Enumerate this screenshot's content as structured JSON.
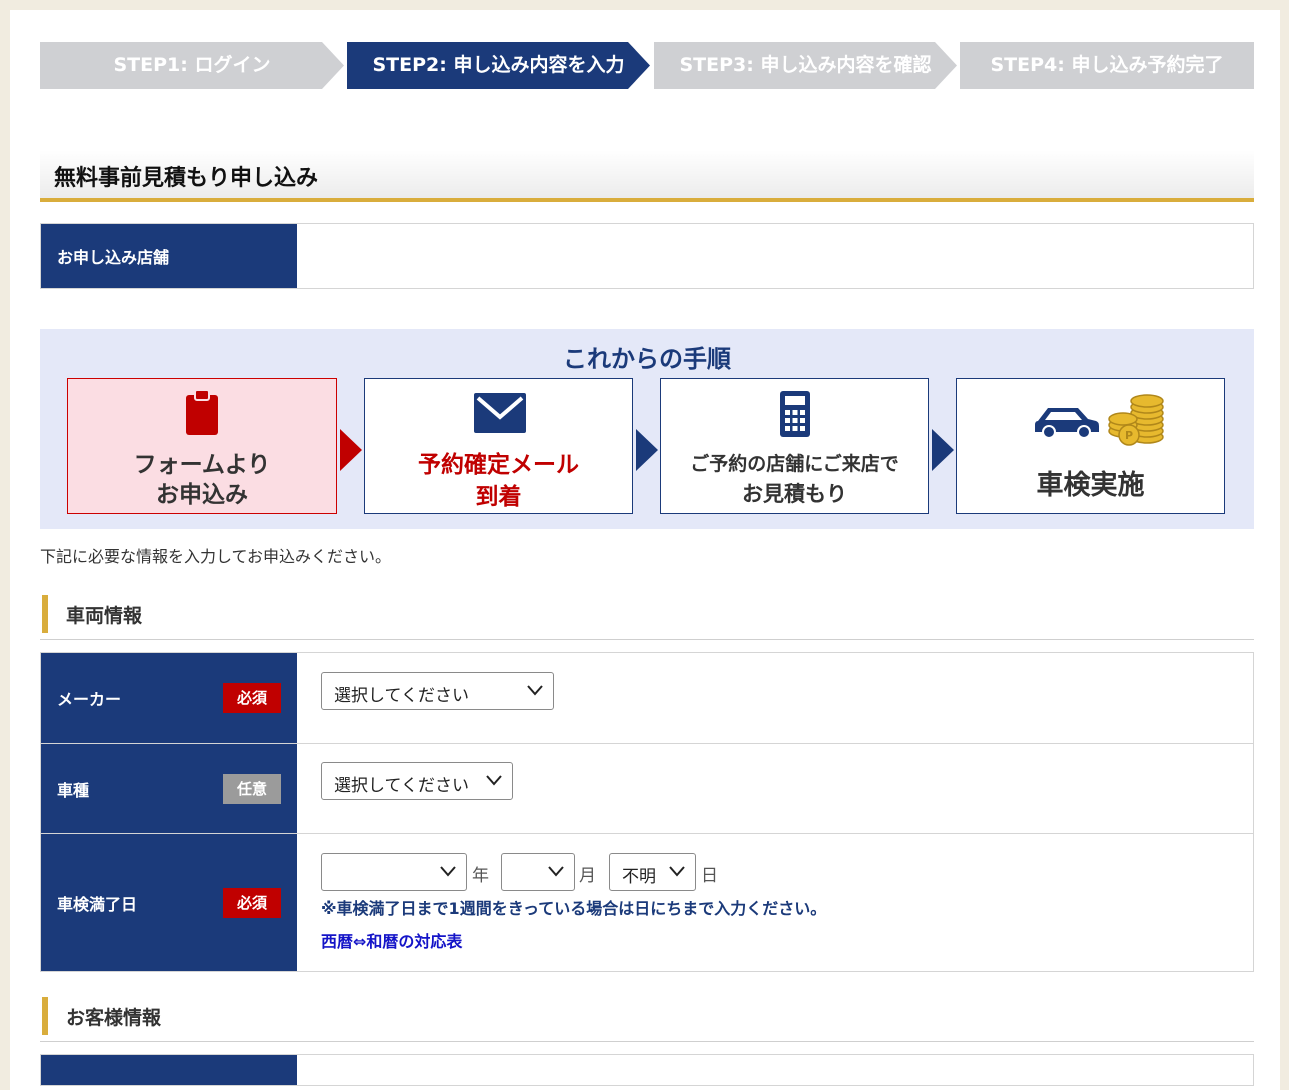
{
  "steps": [
    {
      "label": "STEP1: ログイン",
      "state": "done"
    },
    {
      "label": "STEP2: 申し込み内容を入力",
      "state": "active"
    },
    {
      "label": "STEP3: 申し込み内容を確認",
      "state": "pending"
    },
    {
      "label": "STEP4: 申し込み予約完了",
      "state": "pending"
    }
  ],
  "page_title": "無料事前見積もり申し込み",
  "store": {
    "label": "お申し込み店舗",
    "value": ""
  },
  "procedure": {
    "title": "これからの手順",
    "boxes": [
      {
        "line1": "フォームより",
        "line2": "お申込み",
        "icon": "clipboard-icon"
      },
      {
        "line1": "予約確定メール",
        "line2": "到着",
        "icon": "mail-icon"
      },
      {
        "line1": "ご予約の店舗にご来店で",
        "line2": "お見積もり",
        "icon": "calculator-icon"
      },
      {
        "line1": "車検実施",
        "line2": "",
        "icon": "car-and-coins-icon"
      }
    ]
  },
  "intro": "下記に必要な情報を入力してお申込みください。",
  "vehicle_section": {
    "title": "車両情報",
    "maker": {
      "label": "メーカー",
      "badge": "必須",
      "value": "選択してください"
    },
    "model": {
      "label": "車種",
      "badge": "任意",
      "value": "選択してください"
    },
    "expiry": {
      "label": "車検満了日",
      "badge": "必須",
      "year_value": "",
      "year_unit": "年",
      "month_value": "",
      "month_unit": "月",
      "day_value": "不明",
      "day_unit": "日",
      "note": "※車検満了日まで1週間をきっている場合は日にちまで入力ください。",
      "link": "西暦⇔和暦の対応表"
    }
  },
  "customer_section": {
    "title": "お客様情報"
  },
  "colors": {
    "navy": "#1b3a7a",
    "gold": "#d9ad3c",
    "required_red": "#c00000",
    "optional_gray": "#9b9b9b",
    "step_inactive": "#cfd0d3",
    "procedure_bg": "#e4e8f8",
    "link_blue": "#1414c8"
  }
}
